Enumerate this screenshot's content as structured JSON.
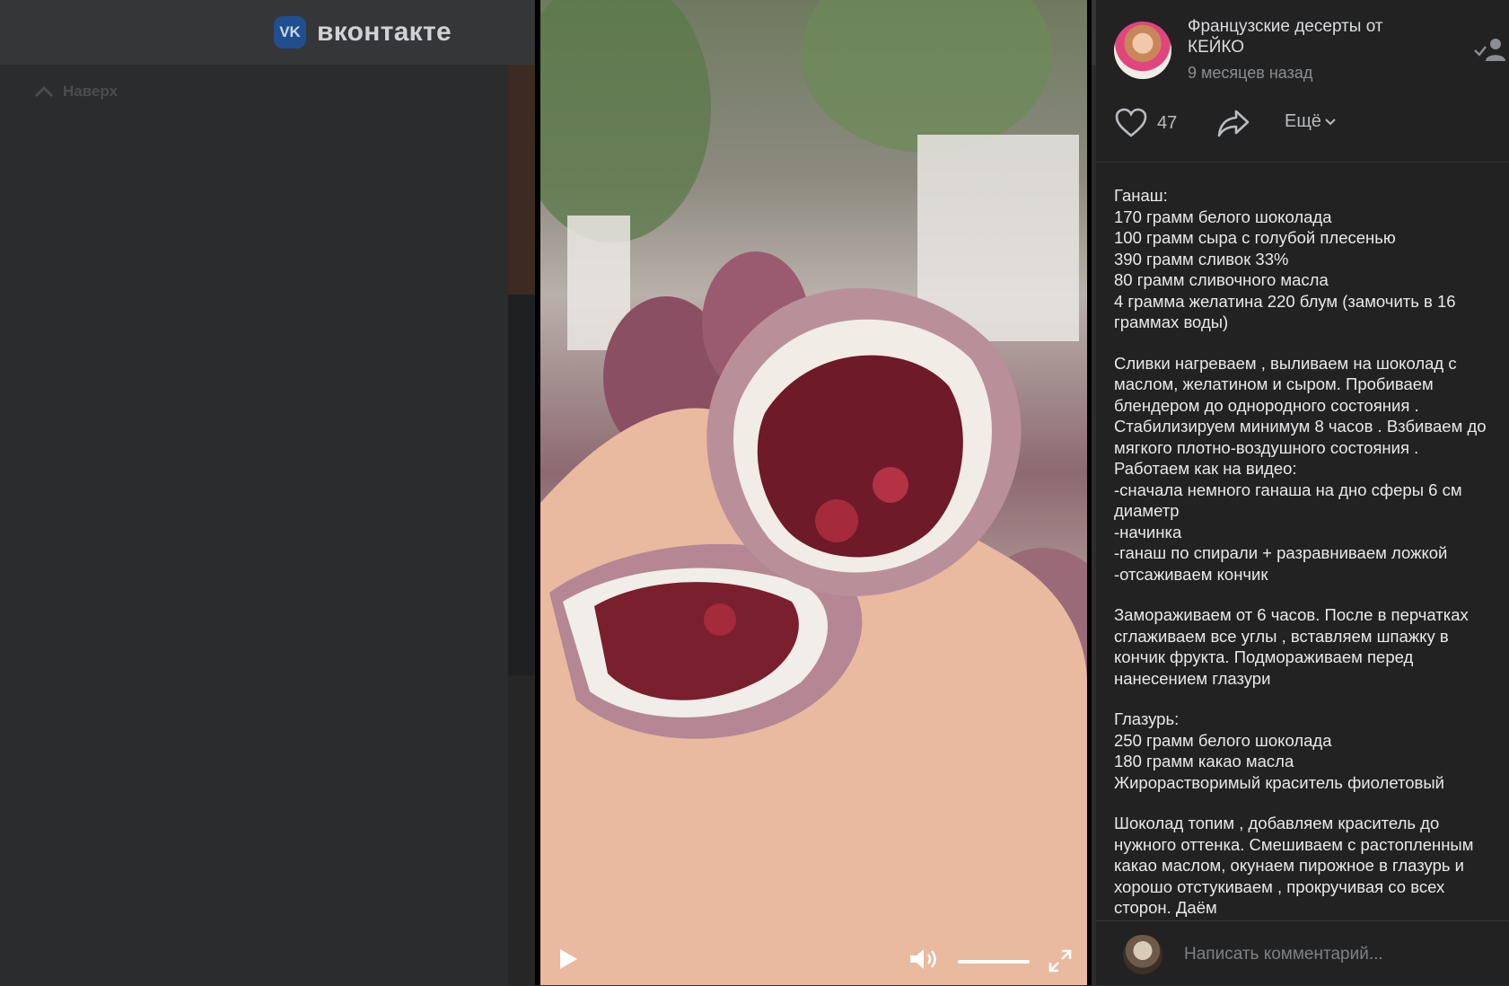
{
  "site": {
    "logo_badge": "VK",
    "logo_text": "вконтакте",
    "back_to_top": "Наверх"
  },
  "post": {
    "author": "Французские десерты от КЕЙКО",
    "time": "9 месяцев назад",
    "likes": "47",
    "more_label": "Ещё",
    "description": [
      "Ганаш:\n170 грамм белого шоколада\n100 грамм сыра с голубой плесенью\n390 грамм сливок 33%\n80 грамм сливочного масла\n4 грамма желатина 220 блум (замочить в 16 граммах воды)",
      "Сливки нагреваем , выливаем на шоколад с маслом, желатином и сыром. Пробиваем блендером до однородного состояния .\nСтабилизируем минимум 8 часов . Взбиваем до мягкого плотно-воздушного состояния .\nРаботаем как на видео:\n-сначала немного ганаша на дно сферы 6 см диаметр\n-начинка\n-ганаш по спирали + разравниваем ложкой\n-отсаживаем кончик",
      "Замораживаем от 6 часов. После в перчатках сглаживаем все углы , вставляем шпажку в кончик фрукта. Подмораживаем перед нанесением глазури",
      "Глазурь:\n250 грамм белого шоколада\n180 грамм какао масла\nЖирорастворимый краситель фиолетовый",
      "Шоколад топим , добавляем краситель до нужного оттенка. Смешиваем с растопленным какао маслом, окунаем пирожное в глазурь и хорошо отстукиваем , прокручивая со всех сторон. Даём"
    ]
  },
  "player": {
    "volume": 1.0
  },
  "comment": {
    "placeholder": "Написать комментарий..."
  },
  "colors": {
    "panel_bg": "#222222",
    "page_bg": "#2b2c2d",
    "topbar_bg": "#353637"
  }
}
